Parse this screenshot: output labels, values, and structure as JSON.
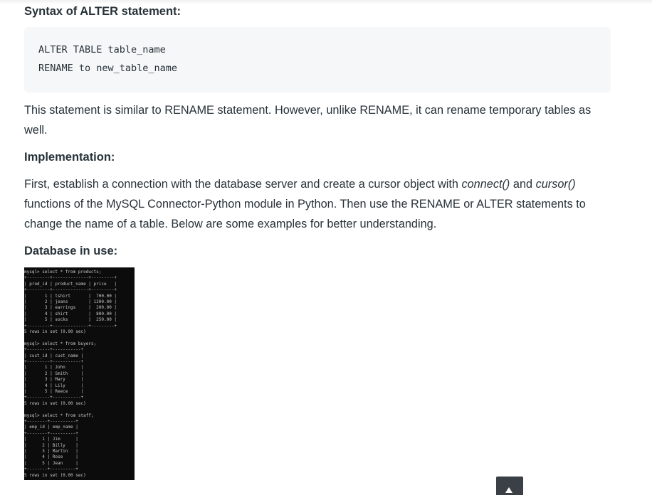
{
  "sections": {
    "syntax_heading": "Syntax of ALTER statement:",
    "code_lines": [
      "ALTER TABLE table_name",
      "RENAME to new_table_name"
    ],
    "para1": "This statement is similar to RENAME statement. However, unlike RENAME, it can rename temporary tables as well.",
    "impl_heading": "Implementation:",
    "para2": {
      "t1": "First, establish a connection with the database server and create a cursor object with ",
      "connect": "connect()",
      "t2": " and ",
      "cursor": "cursor()",
      "t3": " functions of the MySQL Connector-Python module in Python. Then use the RENAME or ALTER statements to change the name of a table. Below are some examples for better understanding."
    },
    "db_heading": "Database in use:"
  },
  "terminal": {
    "lines": [
      "mysql> select * from products;",
      "+---------+--------------+---------+",
      "| prod_id | product_name | price   |",
      "+---------+--------------+---------+",
      "|       1 | tshirt       |  700.00 |",
      "|       2 | jeans        | 1200.00 |",
      "|       3 | earrings     |  200.00 |",
      "|       4 | shirt        |  800.00 |",
      "|       5 | socks        |  250.00 |",
      "+---------+--------------+---------+",
      "5 rows in set (0.00 sec)",
      "",
      "mysql> select * from buyers;",
      "+---------+-----------+",
      "| cust_id | cust_name |",
      "+---------+-----------+",
      "|       1 | John      |",
      "|       2 | Smith     |",
      "|       3 | Mary      |",
      "|       4 | Lily      |",
      "|       5 | Reece     |",
      "+---------+-----------+",
      "5 rows in set (0.00 sec)",
      "",
      "mysql> select * from staff;",
      "+--------+----------+",
      "| emp_id | emp_name |",
      "+--------+----------+",
      "|      1 | Jim      |",
      "|      2 | Billy    |",
      "|      3 | Martin   |",
      "|      4 | Rose     |",
      "|      5 | Jean     |",
      "+--------+----------+",
      "5 rows in set (0.00 sec)"
    ]
  },
  "scroll_to_top": {
    "icon": "arrow-up-icon"
  }
}
